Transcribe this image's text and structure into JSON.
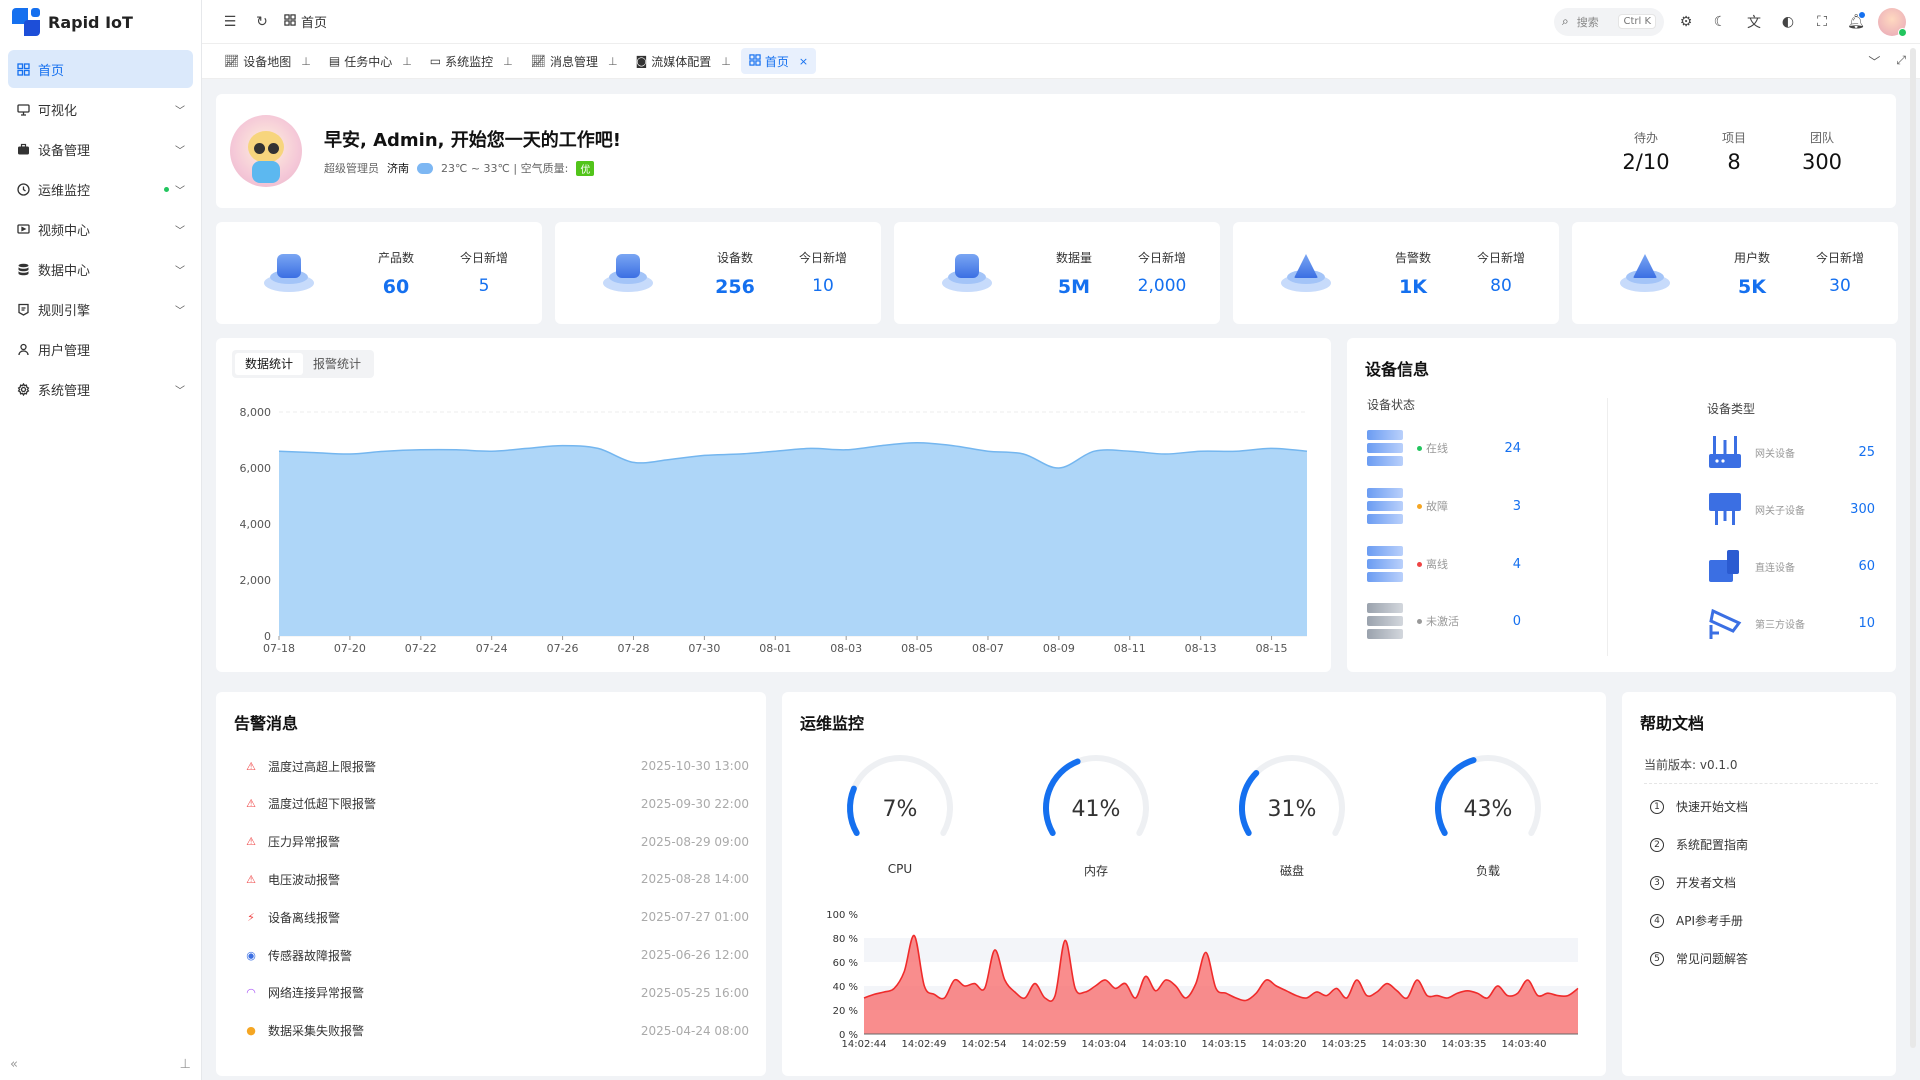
{
  "app": {
    "name": "Rapid IoT"
  },
  "sidebar": {
    "items": [
      {
        "label": "首页",
        "icon": "dashboard-icon",
        "active": true,
        "expandable": false
      },
      {
        "label": "可视化",
        "icon": "monitor-icon",
        "expandable": true
      },
      {
        "label": "设备管理",
        "icon": "briefcase-icon",
        "expandable": true
      },
      {
        "label": "运维监控",
        "icon": "clock-icon",
        "expandable": true,
        "dot": true
      },
      {
        "label": "视频中心",
        "icon": "video-icon",
        "expandable": true
      },
      {
        "label": "数据中心",
        "icon": "database-icon",
        "expandable": true
      },
      {
        "label": "规则引擎",
        "icon": "rule-icon",
        "expandable": true
      },
      {
        "label": "用户管理",
        "icon": "user-icon",
        "expandable": false
      },
      {
        "label": "系统管理",
        "icon": "gear-icon",
        "expandable": true
      }
    ]
  },
  "header": {
    "breadcrumb": "首页",
    "search_placeholder": "搜索",
    "search_shortcut": "Ctrl K"
  },
  "tabs": [
    {
      "label": "设备地图",
      "icon": "chart-icon"
    },
    {
      "label": "任务中心",
      "icon": "file-icon"
    },
    {
      "label": "系统监控",
      "icon": "message-icon"
    },
    {
      "label": "消息管理",
      "icon": "chart-icon"
    },
    {
      "label": "流媒体配置",
      "icon": "camera-icon"
    },
    {
      "label": "首页",
      "icon": "dashboard-icon",
      "active": true
    }
  ],
  "welcome": {
    "title": "早安, Admin, 开始您一天的工作吧!",
    "role": "超级管理员",
    "city": "济南",
    "temp": "23℃ ~ 33℃ | 空气质量:",
    "air_quality": "优",
    "stats": [
      {
        "label": "待办",
        "value": "2/10"
      },
      {
        "label": "项目",
        "value": "8"
      },
      {
        "label": "团队",
        "value": "300"
      }
    ]
  },
  "stats": [
    {
      "label": "产品数",
      "value": "60",
      "new_label": "今日新增",
      "new_value": "5",
      "icon": "product-icon"
    },
    {
      "label": "设备数",
      "value": "256",
      "new_label": "今日新增",
      "new_value": "10",
      "icon": "device-icon"
    },
    {
      "label": "数据量",
      "value": "5M",
      "new_label": "今日新增",
      "new_value": "2,000",
      "icon": "data-icon"
    },
    {
      "label": "告警数",
      "value": "1K",
      "new_label": "今日新增",
      "new_value": "80",
      "icon": "alarm-icon"
    },
    {
      "label": "用户数",
      "value": "5K",
      "new_label": "今日新增",
      "new_value": "30",
      "icon": "users-icon"
    }
  ],
  "chart_tabs": [
    {
      "label": "数据统计",
      "active": true
    },
    {
      "label": "报警统计"
    }
  ],
  "chart_data": [
    {
      "type": "area",
      "x": [
        "07-18",
        "07-19",
        "07-20",
        "07-21",
        "07-22",
        "07-23",
        "07-24",
        "07-25",
        "07-26",
        "07-27",
        "07-28",
        "07-29",
        "07-30",
        "07-31",
        "08-01",
        "08-02",
        "08-03",
        "08-04",
        "08-05",
        "08-06",
        "08-07",
        "08-08",
        "08-09",
        "08-10",
        "08-11",
        "08-12",
        "08-13",
        "08-14",
        "08-15",
        "08-16"
      ],
      "xticks": [
        "07-18",
        "07-20",
        "07-22",
        "07-24",
        "07-26",
        "07-28",
        "07-30",
        "08-01",
        "08-03",
        "08-05",
        "08-07",
        "08-09",
        "08-11",
        "08-13",
        "08-15"
      ],
      "yticks": [
        "0",
        "2,000",
        "4,000",
        "6,000",
        "8,000"
      ],
      "series": [
        {
          "values": [
            6600,
            6550,
            6500,
            6600,
            6650,
            6650,
            6600,
            6700,
            6800,
            6700,
            6200,
            6300,
            6450,
            6500,
            6600,
            6700,
            6650,
            6800,
            6900,
            6800,
            6600,
            6500,
            6000,
            6600,
            6600,
            6500,
            6600,
            6600,
            6700,
            6600
          ]
        }
      ],
      "ylim": [
        0,
        8000
      ],
      "grid": true,
      "color": "#aad4f8"
    },
    {
      "type": "area",
      "xticks": [
        "14:02:44",
        "14:02:49",
        "14:02:54",
        "14:02:59",
        "14:03:04",
        "14:03:10",
        "14:03:15",
        "14:03:20",
        "14:03:25",
        "14:03:30",
        "14:03:35",
        "14:03:40"
      ],
      "yticks": [
        "0 %",
        "20 %",
        "40 %",
        "60 %",
        "80 %",
        "100 %"
      ],
      "series": [
        {
          "values": [
            30,
            33,
            35,
            38,
            52,
            82,
            40,
            33,
            30,
            45,
            40,
            42,
            38,
            70,
            45,
            35,
            30,
            42,
            30,
            32,
            78,
            38,
            35,
            40,
            45,
            38,
            42,
            30,
            48,
            36,
            45,
            40,
            30,
            42,
            68,
            38,
            34,
            30,
            28,
            34,
            45,
            40,
            36,
            32,
            30,
            35,
            32,
            38,
            30,
            45,
            32,
            35,
            42,
            36,
            30,
            45,
            32,
            32,
            30,
            34,
            36,
            34,
            30,
            40,
            32,
            34,
            45,
            32,
            34,
            32,
            32,
            38
          ]
        }
      ],
      "ylim": [
        0,
        100
      ],
      "grid": true,
      "color": "#f87171"
    }
  ],
  "device_info": {
    "title": "设备信息",
    "status_title": "设备状态",
    "type_title": "设备类型",
    "status": [
      {
        "label": "在线",
        "value": "24",
        "color": "#22c55e"
      },
      {
        "label": "故障",
        "value": "3",
        "color": "#f5a623"
      },
      {
        "label": "离线",
        "value": "4",
        "color": "#ef4444"
      },
      {
        "label": "未激活",
        "value": "0",
        "color": "#999999"
      }
    ],
    "types": [
      {
        "label": "网关设备",
        "value": "25",
        "icon": "gateway-icon"
      },
      {
        "label": "网关子设备",
        "value": "300",
        "icon": "sub-device-icon"
      },
      {
        "label": "直连设备",
        "value": "60",
        "icon": "direct-device-icon"
      },
      {
        "label": "第三方设备",
        "value": "10",
        "icon": "camera-device-icon"
      }
    ]
  },
  "alarms": {
    "title": "告警消息",
    "items": [
      {
        "text": "温度过高超上限报警",
        "time": "2025-10-30 13:00",
        "icon": "siren-icon",
        "color": "#ef4444"
      },
      {
        "text": "温度过低超下限报警",
        "time": "2025-09-30 22:00",
        "icon": "siren-icon",
        "color": "#ef4444"
      },
      {
        "text": "压力异常报警",
        "time": "2025-08-29 09:00",
        "icon": "siren-icon",
        "color": "#ef4444"
      },
      {
        "text": "电压波动报警",
        "time": "2025-08-28 14:00",
        "icon": "siren-icon",
        "color": "#ef4444"
      },
      {
        "text": "设备离线报警",
        "time": "2025-07-27 01:00",
        "icon": "offline-icon",
        "color": "#ef4444"
      },
      {
        "text": "传感器故障报警",
        "time": "2025-06-26 12:00",
        "icon": "sensor-icon",
        "color": "#3b6fe3"
      },
      {
        "text": "网络连接异常报警",
        "time": "2025-05-25 16:00",
        "icon": "wifi-icon",
        "color": "#a855f7"
      },
      {
        "text": "数据采集失败报警",
        "time": "2025-04-24 08:00",
        "icon": "warning-icon",
        "color": "#f5a623"
      }
    ]
  },
  "ops": {
    "title": "运维监控",
    "gauges": [
      {
        "label": "CPU",
        "value": 7,
        "display": "7%"
      },
      {
        "label": "内存",
        "value": 41,
        "display": "41%"
      },
      {
        "label": "磁盘",
        "value": 31,
        "display": "31%"
      },
      {
        "label": "负载",
        "value": 43,
        "display": "43%"
      }
    ]
  },
  "help": {
    "title": "帮助文档",
    "version_label": "当前版本:",
    "version": "v0.1.0",
    "items": [
      {
        "num": "1",
        "label": "快速开始文档"
      },
      {
        "num": "2",
        "label": "系统配置指南"
      },
      {
        "num": "3",
        "label": "开发者文档"
      },
      {
        "num": "4",
        "label": "API参考手册"
      },
      {
        "num": "5",
        "label": "常见问题解答"
      }
    ]
  }
}
